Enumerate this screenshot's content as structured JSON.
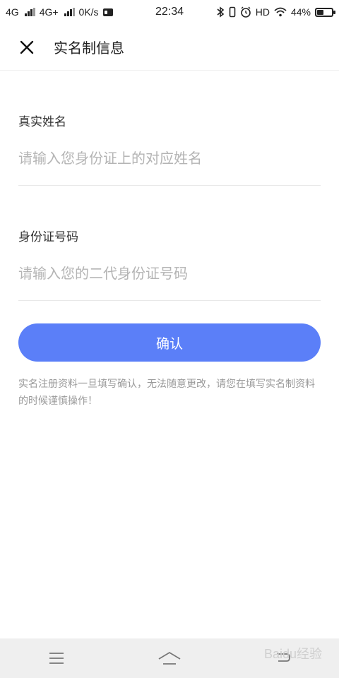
{
  "status_bar": {
    "network_1": "4G",
    "network_2": "4G+",
    "speed": "0K/s",
    "time": "22:34",
    "hd_label": "HD",
    "battery_percent": "44%",
    "battery_level": 0.44,
    "icons": [
      "signal-icon",
      "signal-icon",
      "id-card-icon",
      "bluetooth-icon",
      "vibrate-icon",
      "alarm-icon",
      "wifi-icon",
      "battery-icon"
    ]
  },
  "header": {
    "title": "实名制信息",
    "close_icon": "close-icon"
  },
  "form": {
    "name_label": "真实姓名",
    "name_placeholder": "请输入您身份证上的对应姓名",
    "name_value": "",
    "id_label": "身份证号码",
    "id_placeholder": "请输入您的二代身份证号码",
    "id_value": "",
    "confirm_label": "确认",
    "notice": "实名注册资料一旦填写确认，无法随意更改，请您在填写实名制资料的时候谨慎操作！"
  },
  "nav_bar": {
    "icons": [
      "menu-icon",
      "home-icon",
      "back-icon"
    ]
  },
  "watermark": "Baidu经验",
  "colors": {
    "accent": "#5b7ff8",
    "placeholder": "#b4b4b4",
    "notice": "#9a9a9a",
    "nav_bg": "#efefef"
  }
}
